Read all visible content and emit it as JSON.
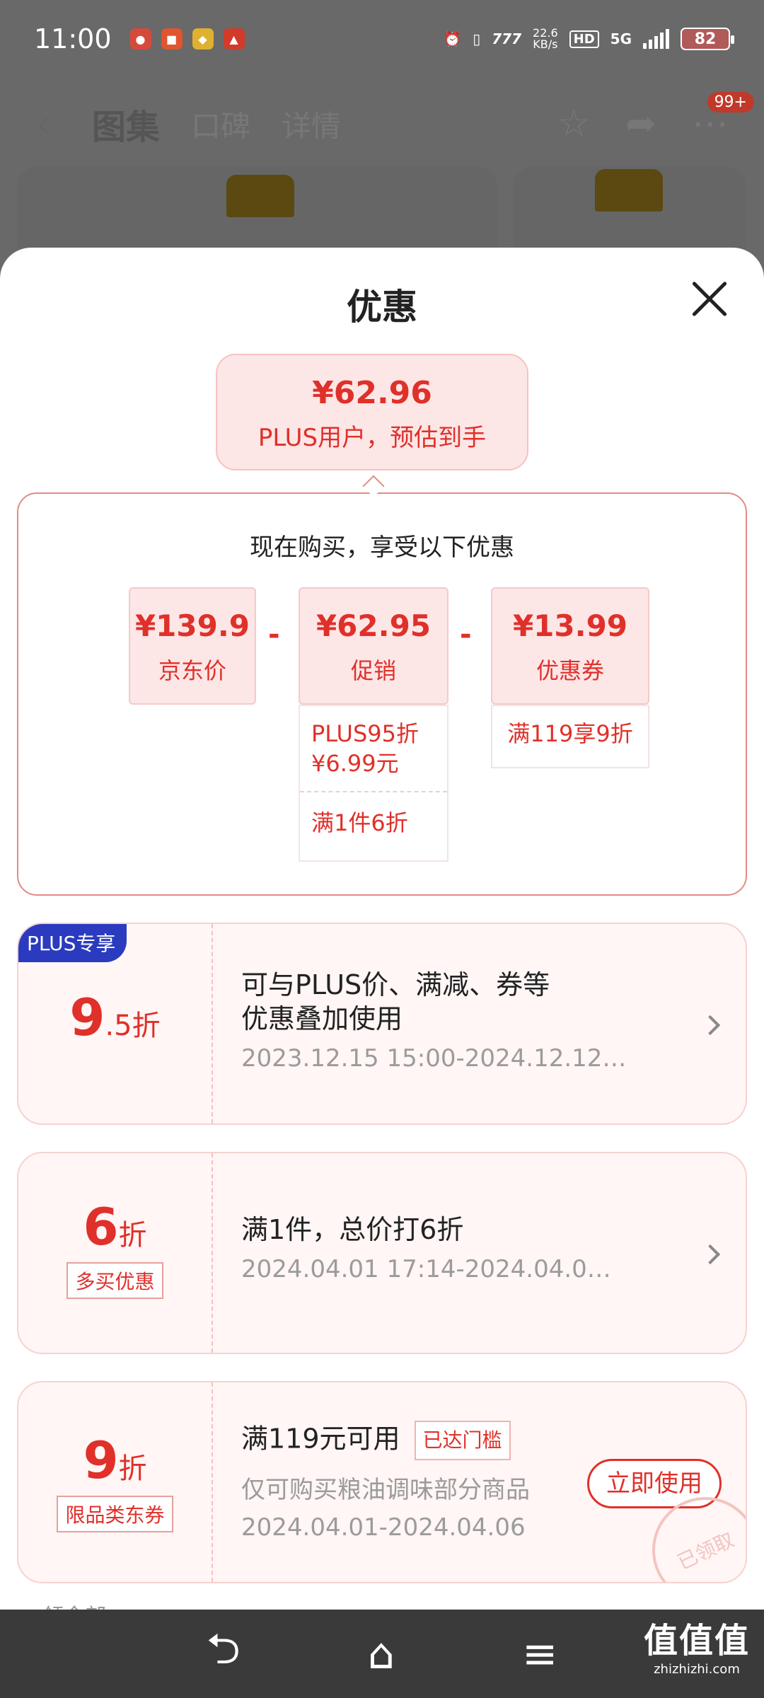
{
  "status": {
    "time": "11:00",
    "net_speed_top": "22.6",
    "net_speed_unit": "KB/s",
    "hd": "HD",
    "network": "5G",
    "battery": "82"
  },
  "nav": {
    "tabs": [
      "图集",
      "口碑",
      "详情"
    ],
    "badge": "99+"
  },
  "sheet": {
    "title": "优惠",
    "estimate": {
      "price": "¥62.96",
      "label": "PLUS用户，预估到手"
    },
    "breakdown": {
      "title": "现在购买，享受以下优惠",
      "jd_price": {
        "value": "¥139.9",
        "label": "京东价"
      },
      "promo": {
        "value": "¥62.95",
        "label": "促销",
        "sub1": "PLUS95折\n¥6.99元",
        "sub1_a": "PLUS95折",
        "sub1_b": "¥6.99元",
        "sub2": "满1件6折"
      },
      "coupon": {
        "value": "¥13.99",
        "label": "优惠券",
        "sub": "满119享9折"
      },
      "minus": "-"
    },
    "offers": [
      {
        "badge": "PLUS专享",
        "big": "9",
        "small": ".5折",
        "text_line1": "可与PLUS价、满减、券等",
        "text_line2": "优惠叠加使用",
        "date": "2023.12.15 15:00-2024.12.12…"
      },
      {
        "big": "6",
        "small": "折",
        "tag": "多买优惠",
        "text": "满1件，总价打6折",
        "date": "2024.04.01 17:14-2024.04.0…"
      },
      {
        "big": "9",
        "small": "折",
        "tag": "限品类东券",
        "text": "满119元可用",
        "reached": "已达门槛",
        "desc": "仅可购买粮油调味部分商品",
        "date": "2024.04.01-2024.04.06",
        "button": "立即使用",
        "stamp": "已领取"
      }
    ],
    "peek": "领全部"
  },
  "watermark": {
    "big": "值值值",
    "small": "zhizhizhi.com"
  }
}
